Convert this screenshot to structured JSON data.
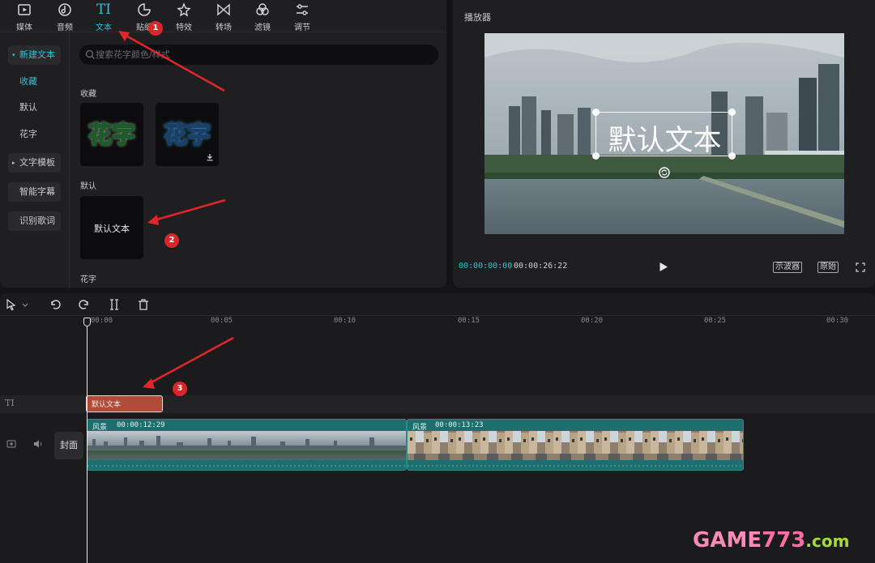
{
  "tabs": [
    {
      "label": "媒体",
      "icon": "media-icon"
    },
    {
      "label": "音频",
      "icon": "audio-icon"
    },
    {
      "label": "文本",
      "icon": "text-icon",
      "glyph": "TI",
      "active": true
    },
    {
      "label": "贴纸",
      "icon": "sticker-icon"
    },
    {
      "label": "特效",
      "icon": "effects-icon"
    },
    {
      "label": "转场",
      "icon": "transition-icon"
    },
    {
      "label": "滤镜",
      "icon": "filter-icon"
    },
    {
      "label": "调节",
      "icon": "adjust-icon"
    }
  ],
  "sidebar": {
    "items": [
      {
        "label": "新建文本",
        "caret": "▾"
      },
      {
        "label": "收藏"
      },
      {
        "label": "默认"
      },
      {
        "label": "花字"
      },
      {
        "label": "文字模板",
        "caret": "▸"
      },
      {
        "label": "智能字幕"
      },
      {
        "label": "识别歌词"
      }
    ]
  },
  "search": {
    "placeholder": "搜索花字颜色/样式"
  },
  "sections": {
    "favorites": "收藏",
    "default": "默认",
    "huazi": "花字"
  },
  "huazi_samples": [
    "花字",
    "花字"
  ],
  "default_card_text": "默认文本",
  "player": {
    "title": "播放器",
    "overlay_text": "默认文本",
    "time_current": "00:00:00:00",
    "time_total": "00:00:26:22",
    "btn_scope": "示波器",
    "btn_original": "原始"
  },
  "timeline": {
    "ticks": [
      "00:00",
      "00:05",
      "00:10",
      "00:15",
      "00:20",
      "00:25",
      "00:30"
    ],
    "text_track_icon": "TI",
    "text_clip_label": "默认文本",
    "cover_label": "封面",
    "clips": [
      {
        "label": "风景",
        "duration": "00:00:12:29"
      },
      {
        "label": "风景",
        "duration": "00:00:13:23"
      }
    ]
  },
  "annotations": [
    "1",
    "2",
    "3"
  ],
  "watermark": {
    "prefix": "GAME",
    "number": "773",
    "suffix": ".com"
  },
  "colors": {
    "accent": "#2ec4d6",
    "text_clip": "#b04a39",
    "video_clip": "#1d6f6e",
    "marker": "#d8262a"
  }
}
